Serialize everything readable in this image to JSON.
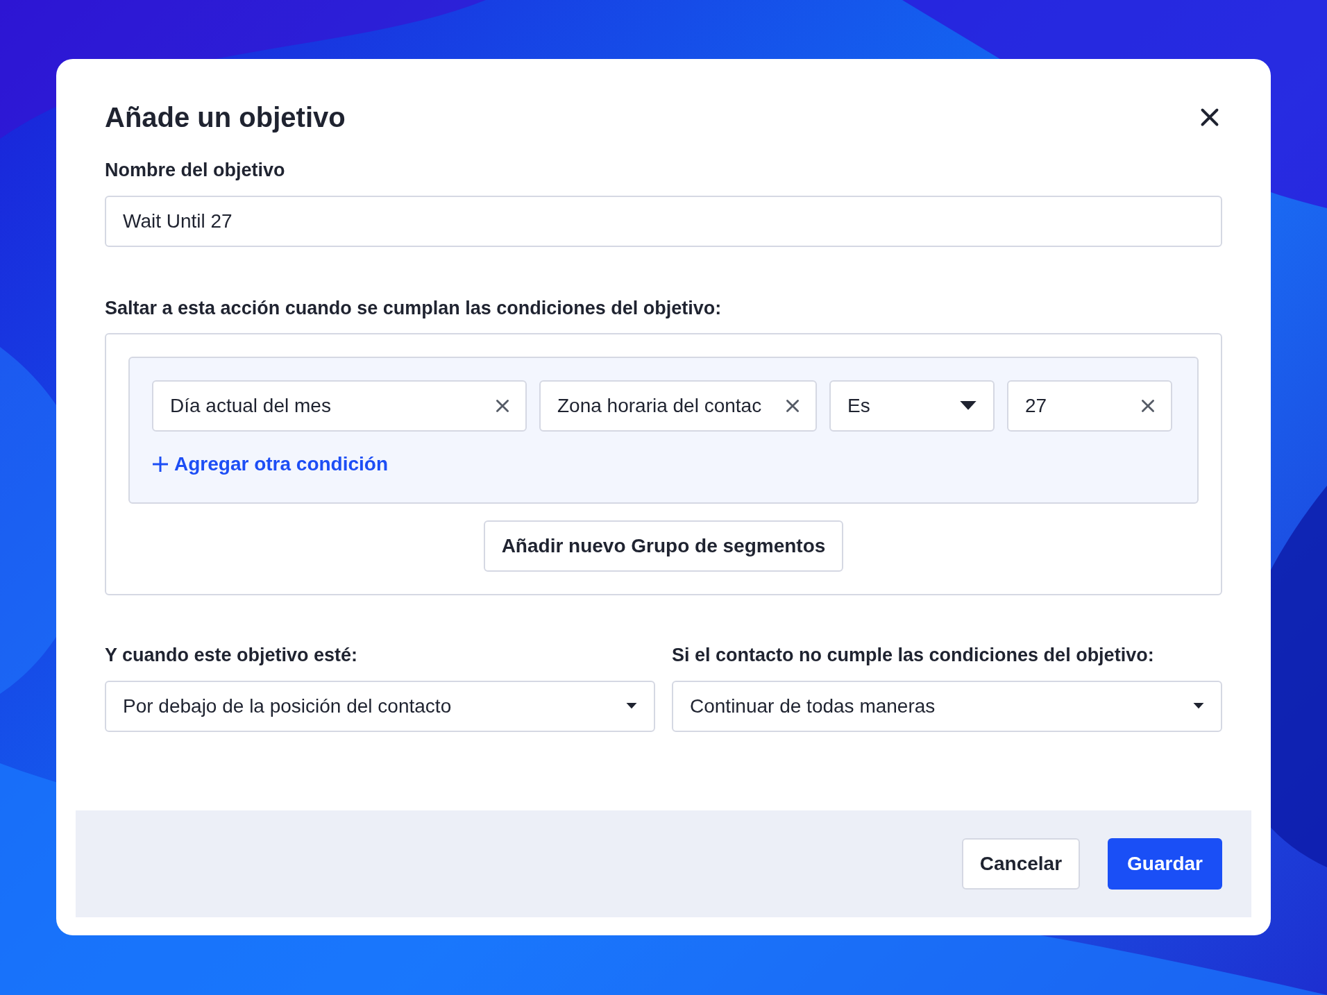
{
  "dialog": {
    "title": "Añade un objetivo"
  },
  "name_field": {
    "label": "Nombre del objetivo",
    "value": "Wait Until 27"
  },
  "conditions": {
    "label": "Saltar a esta acción cuando se cumplan las condiciones del objetivo:",
    "fields": [
      {
        "kind": "clearable",
        "value": "Día actual del mes"
      },
      {
        "kind": "clearable",
        "value": "Zona horaria del contac"
      },
      {
        "kind": "dropdown",
        "value": "Es"
      },
      {
        "kind": "clearable",
        "value": "27"
      }
    ],
    "add_link": "Agregar otra condición",
    "add_group_button": "Añadir nuevo Grupo de segmentos"
  },
  "selects": [
    {
      "label": "Y cuando este objetivo esté:",
      "value": "Por debajo de la posición del contacto"
    },
    {
      "label": "Si el contacto no cumple las condiciones del objetivo:",
      "value": "Continuar de todas maneras"
    }
  ],
  "buttons": [
    {
      "kind": "secondary",
      "label": "Cancelar"
    },
    {
      "kind": "primary",
      "label": "Guardar"
    }
  ]
}
